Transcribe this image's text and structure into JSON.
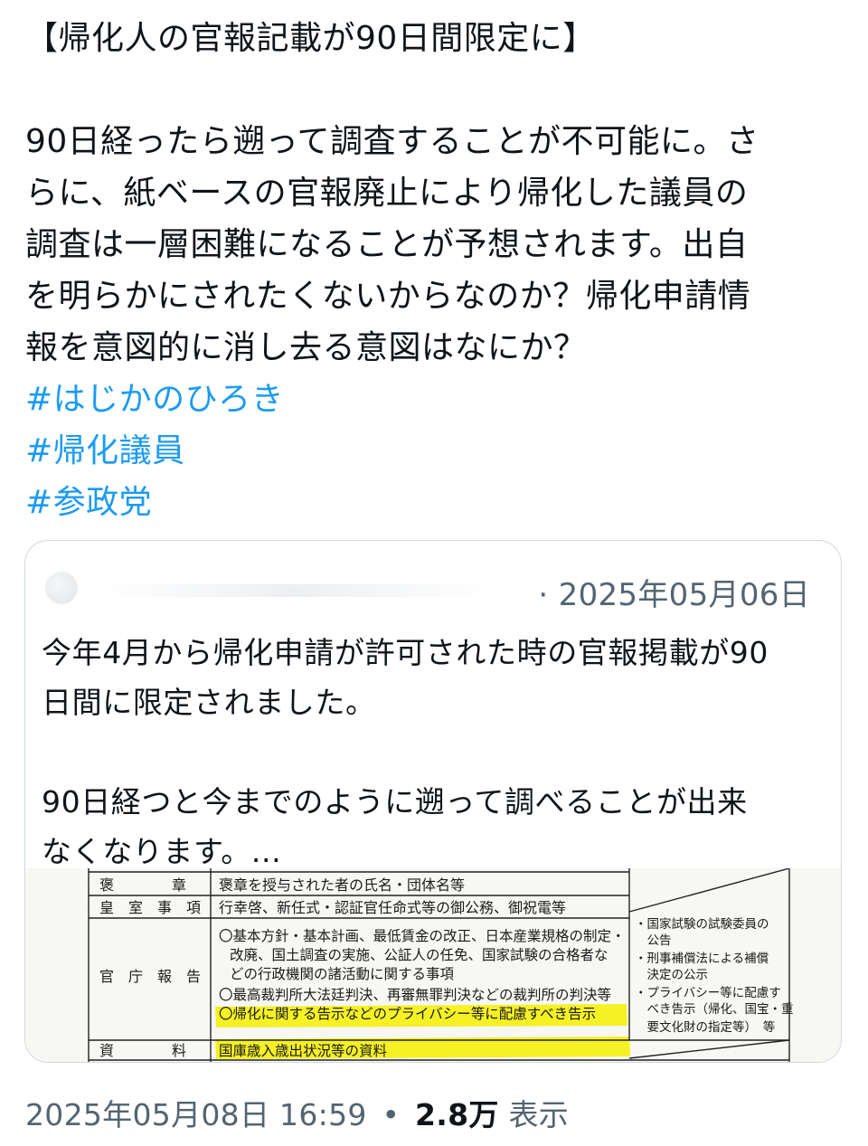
{
  "tweet": {
    "title": "【帰化人の官報記載が90日間限定に】",
    "lines": [
      "90日経ったら遡って調査することが不可能に。さ",
      "らに、紙ベースの官報廃止により帰化した議員の",
      "調査は一層困難になることが予想されます。出自",
      "を明らかにされたくないからなのか？帰化申請情",
      "報を意図的に消し去る意図はなにか？"
    ],
    "hashtags": [
      "#はじかのひろき",
      "#帰化議員",
      "#参政党"
    ]
  },
  "quote": {
    "date": "· 2025年05月06日",
    "para1_lines": [
      "今年4月から帰化申請が許可された時の官報掲載が90",
      "日間に限定されました。"
    ],
    "para2_lines": [
      "90日経つと今までのように遡って調べることが出来",
      "なくなります。..."
    ]
  },
  "document": {
    "rows": [
      {
        "label": "褒　　　　章",
        "content": "褒章を授与された者の氏名・団体名等"
      },
      {
        "label": "皇　室　事　項",
        "content": "行幸啓、新任式・認証官任命式等の御公務、御祝電等"
      },
      {
        "label": "官　庁　報　告",
        "content_lines": [
          "〇基本方針・基本計画、最低賃金の改正、日本産業規格の制定・",
          "改廃、国土調査の実施、公証人の任免、国家試験の合格者な",
          "どの行政機関の諸活動に関する事項",
          "〇最高裁判所大法廷判決、再審無罪判決などの裁判所の判決等",
          "〇帰化に関する告示などのプライバシー等に配慮すべき告示"
        ]
      },
      {
        "label": "資　　　　料",
        "content": "国庫歳入歳出状況等の資料"
      }
    ],
    "side_notes": [
      "・国家試験の試験委員の",
      "　公告",
      "・刑事補償法による補償",
      "　決定の公示",
      "・プライバシー等に配慮す",
      "　べき告示（帰化、国宝・重",
      "　要文化財の指定等）　等"
    ],
    "highlight_color": "#f5f000"
  },
  "meta": {
    "datetime": "2025年05月08日 16:59",
    "separator": "•",
    "views_count": "2.8万",
    "views_label": "表示"
  },
  "colors": {
    "text": "#0f1419",
    "secondary": "#536471",
    "link": "#1d9bf0",
    "border": "#cfd9de"
  }
}
